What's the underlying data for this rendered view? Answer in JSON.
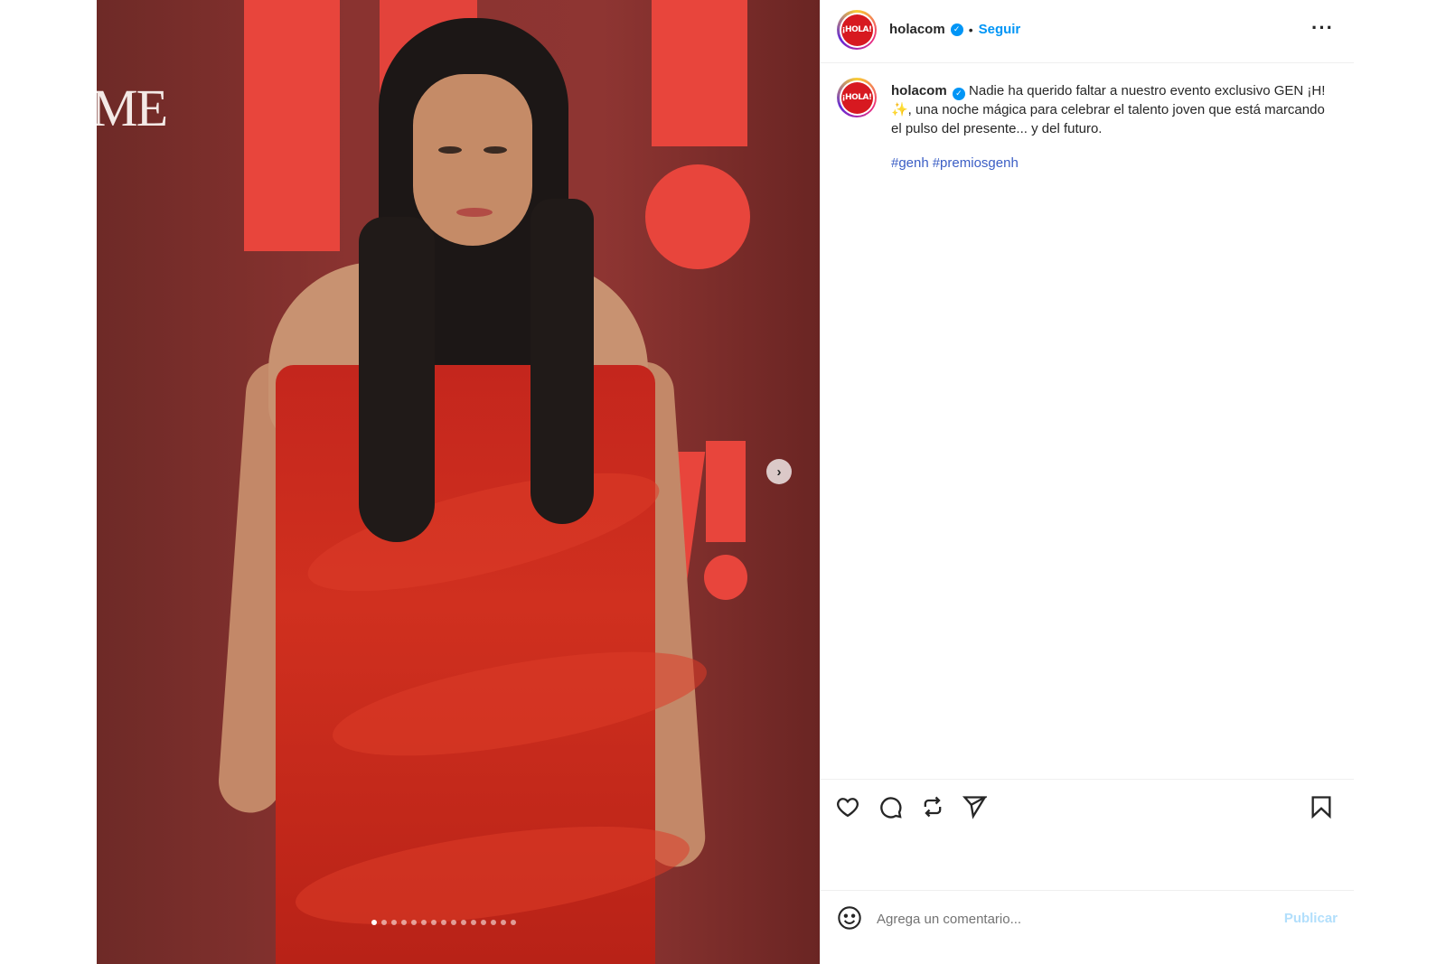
{
  "post": {
    "username": "holacom",
    "follow_label": "Seguir",
    "separator": "•",
    "more_label": "···",
    "avatar_text": "¡HOLA!",
    "caption": "Nadie ha querido faltar a nuestro evento exclusivo GEN ¡H! ✨, una noche mágica para celebrar el talento joven que está marcando el pulso del presente... y del futuro.",
    "hashtags": [
      "#genh",
      "#premiosgenh"
    ]
  },
  "media": {
    "backdrop_fragment": "ME",
    "next_label": "›",
    "carousel_count": 15,
    "carousel_active_index": 0
  },
  "actions": {
    "icons": [
      "heart-icon",
      "comment-icon",
      "repost-icon",
      "share-icon",
      "bookmark-icon"
    ]
  },
  "comment_box": {
    "placeholder": "Agrega un comentario...",
    "publish_label": "Publicar"
  },
  "colors": {
    "accent": "#0095f6",
    "brand_red": "#d71920",
    "backdrop": "#8a3330",
    "dress": "#c4261d"
  }
}
